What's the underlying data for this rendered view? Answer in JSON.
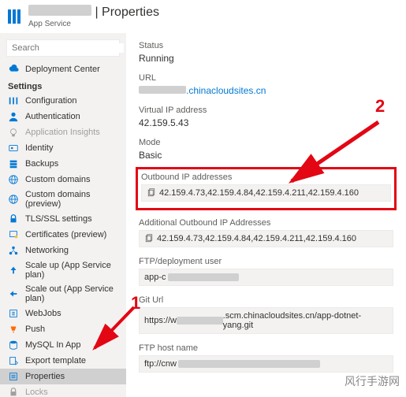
{
  "header": {
    "app_name_suffix": " | Properties",
    "subtitle": "App Service"
  },
  "search": {
    "placeholder": "Search"
  },
  "sidebar": {
    "deployment_center": "Deployment Center",
    "section_settings": "Settings",
    "configuration": "Configuration",
    "authentication": "Authentication",
    "application_insights": "Application Insights",
    "identity": "Identity",
    "backups": "Backups",
    "custom_domains": "Custom domains",
    "custom_domains_preview": "Custom domains (preview)",
    "tls_ssl": "TLS/SSL settings",
    "certificates": "Certificates (preview)",
    "networking": "Networking",
    "scale_up": "Scale up (App Service plan)",
    "scale_out": "Scale out (App Service plan)",
    "webjobs": "WebJobs",
    "push": "Push",
    "mysql": "MySQL In App",
    "export_template": "Export template",
    "properties": "Properties",
    "locks": "Locks"
  },
  "content": {
    "status_label": "Status",
    "status_value": "Running",
    "url_label": "URL",
    "url_value": ".chinacloudsites.cn",
    "vip_label": "Virtual IP address",
    "vip_value": "42.159.5.43",
    "mode_label": "Mode",
    "mode_value": "Basic",
    "outbound_label": "Outbound IP addresses",
    "outbound_value": "42.159.4.73,42.159.4.84,42.159.4.211,42.159.4.160",
    "additional_outbound_label": "Additional Outbound IP Addresses",
    "additional_outbound_value": "42.159.4.73,42.159.4.84,42.159.4.211,42.159.4.160",
    "ftp_user_label": "FTP/deployment user",
    "ftp_user_value": "app-c",
    "git_url_label": "Git Url",
    "git_url_value_prefix": "https://w",
    "git_url_value_suffix": ".scm.chinacloudsites.cn/app-dotnet-yang.git",
    "ftp_host_label": "FTP host name",
    "ftp_host_value": "ftp://cnw"
  },
  "annotations": {
    "num1": "1",
    "num2": "2"
  },
  "watermark": "风行手游网"
}
